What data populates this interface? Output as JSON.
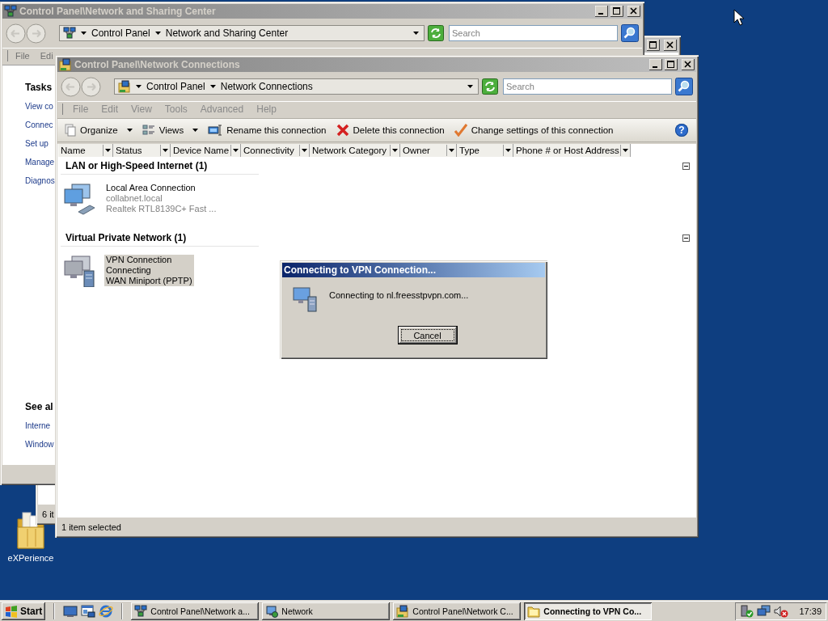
{
  "desktop": {
    "icons": [
      {
        "label": "eXPerience"
      }
    ]
  },
  "windows": [
    {
      "kind": "behind",
      "active": false,
      "title_buttons": [
        {
          "kind": "maximize"
        },
        {
          "kind": "close"
        }
      ],
      "status": "6 it"
    },
    {
      "kind": "sharing",
      "active": false,
      "title": "Control Panel\\Network and Sharing Center",
      "title_buttons": [
        {
          "kind": "minimize"
        },
        {
          "kind": "maximize"
        },
        {
          "kind": "close"
        }
      ],
      "address": [
        "Control Panel",
        "Network and Sharing Center"
      ],
      "search": {
        "placeholder": "Search"
      },
      "menu": [
        "File",
        "Edi"
      ],
      "tasks": {
        "heading": "Tasks",
        "links": [
          "View co",
          "Connec",
          "Set up",
          "Manage",
          "Diagnos"
        ]
      },
      "see_also": {
        "heading": "See al",
        "links": [
          "Interne",
          "Window"
        ]
      }
    },
    {
      "kind": "connections",
      "active": false,
      "title": "Control Panel\\Network Connections",
      "title_buttons": [
        {
          "kind": "minimize"
        },
        {
          "kind": "maximize"
        },
        {
          "kind": "close"
        }
      ],
      "address": [
        "Control Panel",
        "Network Connections"
      ],
      "search": {
        "placeholder": "Search"
      },
      "menu": [
        "File",
        "Edit",
        "View",
        "Tools",
        "Advanced",
        "Help"
      ],
      "commands": [
        {
          "kind": "organize",
          "label": "Organize",
          "dropdown": true
        },
        {
          "kind": "views",
          "label": "Views",
          "dropdown": true
        },
        {
          "kind": "rename",
          "label": "Rename this connection",
          "dropdown": false
        },
        {
          "kind": "delete",
          "label": "Delete this connection",
          "dropdown": false
        },
        {
          "kind": "settings",
          "label": "Change settings of this connection",
          "dropdown": false
        }
      ],
      "help": "?",
      "columns": [
        "Name",
        "Status",
        "Device Name",
        "Connectivity",
        "Network Category",
        "Owner",
        "Type",
        "Phone # or Host Address"
      ],
      "groups": [
        {
          "label": "LAN or High-Speed Internet (1)",
          "expanded": true,
          "items": [
            {
              "kind": "lan",
              "selected": false,
              "lines": [
                "Local Area Connection",
                "collabnet.local",
                "Realtek RTL8139C+ Fast ..."
              ]
            }
          ]
        },
        {
          "label": "Virtual Private Network (1)",
          "expanded": true,
          "items": [
            {
              "kind": "vpn",
              "selected": true,
              "lines": [
                "VPN Connection",
                "Connecting",
                "WAN Miniport (PPTP)"
              ]
            }
          ]
        }
      ],
      "status": "1 item selected"
    }
  ],
  "dialog": {
    "title": "Connecting to VPN Connection...",
    "active": true,
    "message": "Connecting to nl.freesstpvpn.com...",
    "buttons": [
      {
        "label": "Cancel",
        "focused": true
      }
    ]
  },
  "taskbar": {
    "start": "Start",
    "quick_launch": [
      {
        "kind": "desktop"
      },
      {
        "kind": "server"
      },
      {
        "kind": "browser"
      }
    ],
    "tasks": [
      {
        "kind": "network-center",
        "label": "Control Panel\\Network a...",
        "selected": false
      },
      {
        "kind": "network",
        "label": "Network",
        "selected": false
      },
      {
        "kind": "connections",
        "label": "Control Panel\\Network C...",
        "selected": false
      },
      {
        "kind": "folder",
        "label": "Connecting to VPN Co...",
        "selected": true
      }
    ],
    "tray": [
      {
        "kind": "security"
      },
      {
        "kind": "network"
      },
      {
        "kind": "volume"
      }
    ],
    "clock": "17:39"
  }
}
